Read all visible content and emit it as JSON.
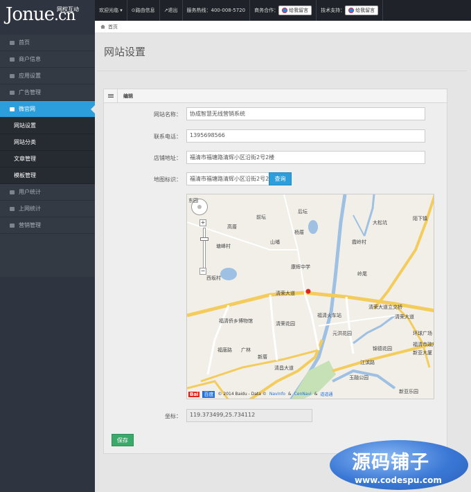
{
  "logo": {
    "text": "Jonue",
    "suffix": ".cn",
    "tagline": "网权互动"
  },
  "topnav": {
    "welcome": "欢迎光临 ▾",
    "router": "⊙路由信息",
    "logout": "↗退出",
    "hotline": "服务热线：400-008-5720",
    "biz": "商务合作：",
    "biz_button": "给我留言",
    "tech": "技术支持：",
    "tech_button": "给我留言"
  },
  "sidebar": {
    "items": [
      {
        "label": "首页"
      },
      {
        "label": "商户信息"
      },
      {
        "label": "应用设置"
      },
      {
        "label": "广告管理"
      },
      {
        "label": "微官网"
      }
    ],
    "sub_items": [
      {
        "label": "网站设置"
      },
      {
        "label": "网站分类"
      },
      {
        "label": "文章管理"
      },
      {
        "label": "模板管理"
      }
    ],
    "bottom_items": [
      {
        "label": "用户统计"
      },
      {
        "label": "上网统计"
      },
      {
        "label": "营销管理"
      }
    ]
  },
  "breadcrumb": {
    "home": "首页"
  },
  "page": {
    "title": "网站设置"
  },
  "panel": {
    "title": "编辑"
  },
  "form": {
    "site_name_label": "网站名称：",
    "site_name_value": "协成智慧无线营销系统",
    "phone_label": "联系电话：",
    "phone_value": "1395698566",
    "address_label": "店铺地址：",
    "address_value": "福清市福塘路清辉小区沿街2号2楼",
    "map_label": "地图标识：",
    "map_value": "福清市福塘路清辉小区沿街2号2楼",
    "query_button": "查询",
    "coord_label": "坐标：",
    "coord_value": "119.373499,25.734112",
    "save_button": "保存"
  },
  "map": {
    "labels": {
      "l1": "东园",
      "l2": "前坛",
      "l3": "后坛",
      "l4": "高厝",
      "l5": "杨厝",
      "l6": "大松坑",
      "l7": "陌下镇",
      "l8": "山埔",
      "l9": "塘峰村",
      "l10": "霞岭村",
      "l11": "西坂村",
      "l12": "康辉中学",
      "l13": "岭尾",
      "l14": "清荣大道",
      "l15": "清荣大道立交桥",
      "l16": "福清侨乡博物馆",
      "l17": "清荣花园",
      "l18": "福清火车站",
      "l19": "清荣大道",
      "l20": "元洪花园",
      "l21": "环球广场",
      "l22": "福清市政府",
      "l23": "新亚大厦",
      "l24": "锦德花园",
      "l25": "玉融公园",
      "l26": "新亚乐园",
      "l27": "广林",
      "l28": "新厝",
      "l29": "福唐路",
      "l30": "清昌大道",
      "l31": "江滨路"
    },
    "footer": {
      "logo_a": "Bai",
      "logo_b": "百度",
      "copyright": "© 2014 Baidu - Data ©",
      "navinfo": "NavInfo",
      "amp1": "&",
      "cennavi": "CenNavi",
      "amp2": "&",
      "daodaotong": "道道通"
    }
  },
  "watermark": {
    "title": "源码铺子",
    "url": "www.codespu.com"
  },
  "colors": {
    "accent": "#2d9edc",
    "save": "#3aa96a",
    "sidebar": "#343a44",
    "topbar": "#1f2329"
  }
}
